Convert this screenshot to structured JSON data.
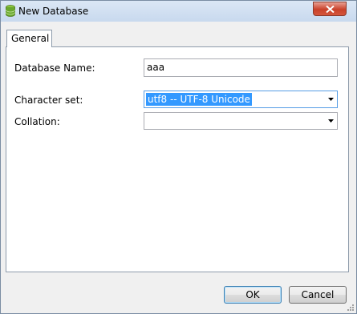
{
  "window": {
    "title": "New Database",
    "title_icon": "database-icon",
    "close_icon": "close-icon"
  },
  "tabs": [
    {
      "label": "General",
      "active": true
    }
  ],
  "form": {
    "database_name": {
      "label": "Database Name:",
      "value": "aaa"
    },
    "character_set": {
      "label": "Character set:",
      "value": "utf8 -- UTF-8 Unicode"
    },
    "collation": {
      "label": "Collation:",
      "value": ""
    }
  },
  "buttons": {
    "ok": "OK",
    "cancel": "Cancel"
  },
  "colors": {
    "selection": "#3399ff",
    "close_button": "#c9412a",
    "focus_border": "#569de5"
  }
}
